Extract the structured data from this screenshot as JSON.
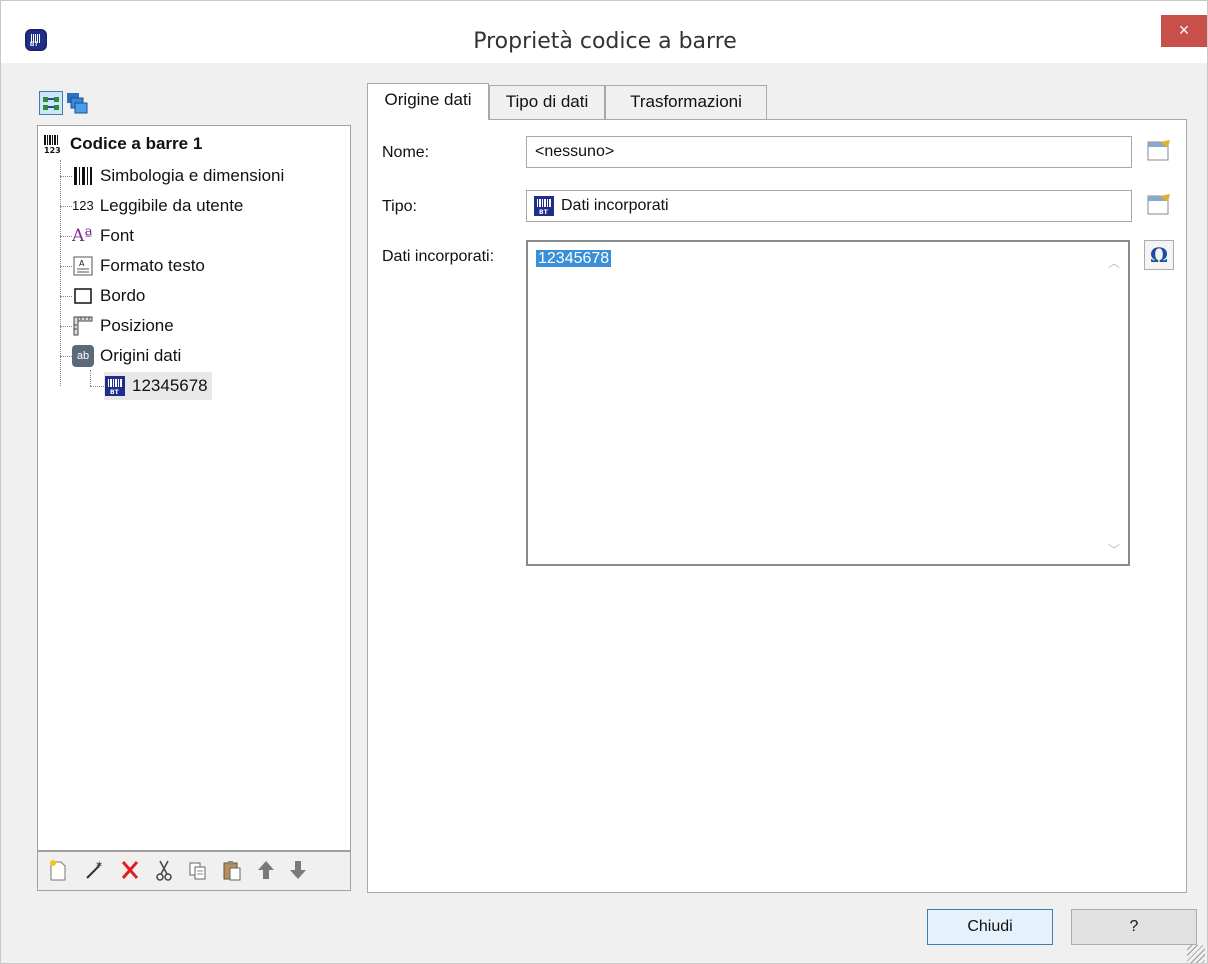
{
  "window": {
    "title": "Proprietà codice a barre",
    "close_glyph": "×"
  },
  "left_toolbar": {
    "icons": [
      "structure-view-icon",
      "layers-view-icon"
    ]
  },
  "tree": {
    "root": "Codice a barre 1",
    "items": [
      {
        "label": "Simbologia e dimensioni",
        "icon": "barcode-bars-icon"
      },
      {
        "label": "Leggibile da utente",
        "icon": "digits-icon",
        "icon_text": "123"
      },
      {
        "label": "Font",
        "icon": "font-icon",
        "icon_text": "Aª"
      },
      {
        "label": "Formato testo",
        "icon": "text-format-icon"
      },
      {
        "label": "Bordo",
        "icon": "border-icon"
      },
      {
        "label": "Posizione",
        "icon": "ruler-icon"
      },
      {
        "label": "Origini dati",
        "icon": "data-sources-icon",
        "icon_text": "ab"
      }
    ],
    "child": {
      "label": "12345678",
      "icon": "embedded-data-icon"
    }
  },
  "bottom_toolbar": {
    "buttons": [
      "new-icon",
      "wizard-icon",
      "delete-icon",
      "cut-icon",
      "copy-icon",
      "paste-icon",
      "move-up-icon",
      "move-down-icon"
    ]
  },
  "tabs": [
    "Origine dati",
    "Tipo di dati",
    "Trasformazioni"
  ],
  "form": {
    "name_label": "Nome:",
    "name_value": "<nessuno>",
    "type_label": "Tipo:",
    "type_value": "Dati incorporati",
    "data_label": "Dati incorporati:",
    "data_value": "12345678",
    "omega": "Ω"
  },
  "buttons": {
    "close": "Chiudi",
    "help": "?"
  },
  "colors": {
    "close_red": "#c7504b",
    "selection_blue": "#3a8fd9",
    "app_icon_blue": "#1f2e8a"
  }
}
